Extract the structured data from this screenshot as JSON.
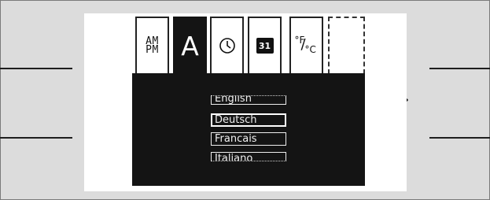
{
  "window": {
    "background": "#dcdcdc",
    "screen_background": "#ffffff",
    "content_background": "#141414"
  },
  "navigation": {
    "left": {
      "icon": "chevron-left-icon"
    },
    "right": {
      "icon": "chevron-right-icon"
    },
    "up": {
      "icon": "chevron-up-icon"
    },
    "down": {
      "icon": "chevron-down-icon"
    },
    "back": {
      "icon": "back-arrow-icon"
    }
  },
  "tabs": [
    {
      "name": "time-format",
      "label_line1": "AM",
      "label_line2": "PM",
      "active": false
    },
    {
      "name": "language",
      "label": "A",
      "active": true
    },
    {
      "name": "clock",
      "icon": "clock-icon",
      "active": false
    },
    {
      "name": "date",
      "label": "31",
      "icon": "calendar-icon",
      "active": false
    },
    {
      "name": "units",
      "label_f": "°F",
      "label_c": "°C",
      "icon": "temperature-units-icon",
      "active": false
    },
    {
      "name": "empty-slot",
      "active": false
    }
  ],
  "languages": [
    {
      "label": "English",
      "selected": false,
      "clipped": "top"
    },
    {
      "label": "Deutsch",
      "selected": true,
      "clipped": "none"
    },
    {
      "label": "Francais",
      "selected": false,
      "clipped": "none"
    },
    {
      "label": "Italiano",
      "selected": false,
      "clipped": "bottom"
    }
  ]
}
